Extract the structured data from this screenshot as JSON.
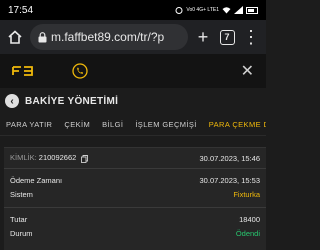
{
  "status_bar": {
    "time": "17:54",
    "network": "Vo0 4G+ LTE1"
  },
  "browser": {
    "url": "m.faffbet89.com/tr/?p",
    "tab_count": "7"
  },
  "site": {
    "logo": "FB"
  },
  "page": {
    "title": "BAKİYE YÖNETİMİ"
  },
  "tabs": [
    {
      "label": "PARA YATIR"
    },
    {
      "label": "ÇEKİM"
    },
    {
      "label": "BİLGİ"
    },
    {
      "label": "İŞLEM GEÇMİŞİ"
    },
    {
      "label": "PARA ÇEKME DURUM"
    }
  ],
  "record": {
    "id_label": "KİMLİK:",
    "id_value": "210092662",
    "id_date": "30.07.2023, 15:46",
    "payment_time_label": "Ödeme Zamanı",
    "payment_time_value": "30.07.2023, 15:53",
    "system_label": "Sistem",
    "system_value": "Fixturka",
    "amount_label": "Tutar",
    "amount_value": "18400",
    "status_label": "Durum",
    "status_value": "Ödendi"
  },
  "colors": {
    "accent": "#f0b90b",
    "success": "#28c76f",
    "background": "#1c1c1c"
  }
}
